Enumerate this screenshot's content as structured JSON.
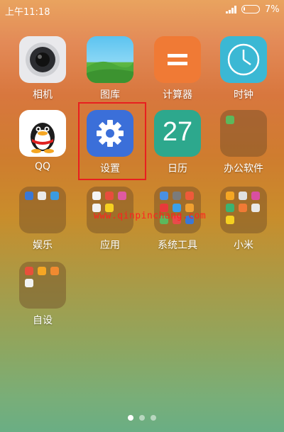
{
  "status_bar": {
    "time": "上午11:18",
    "battery_percent_text": "7%",
    "battery_level": 0.07
  },
  "apps": {
    "camera": "相机",
    "gallery": "图库",
    "calculator": "计算器",
    "clock": "时钟",
    "qq": "QQ",
    "settings": "设置",
    "calendar": "日历",
    "calendar_day": "27",
    "office": "办公软件",
    "entertainment": "娱乐",
    "applications": "应用",
    "system_tools": "系统工具",
    "xiaomi": "小米",
    "custom": "自设"
  },
  "watermark": "www.qinpinchang.com",
  "page_indicator": {
    "pages": 3,
    "current": 1
  },
  "colors": {
    "highlight_box": "#e81f1f",
    "settings_icon": "#3b6fd9",
    "calendar_icon": "#2da88d",
    "calculator_icon": "#f07a35",
    "clock_icon": "#3bb8d4"
  }
}
